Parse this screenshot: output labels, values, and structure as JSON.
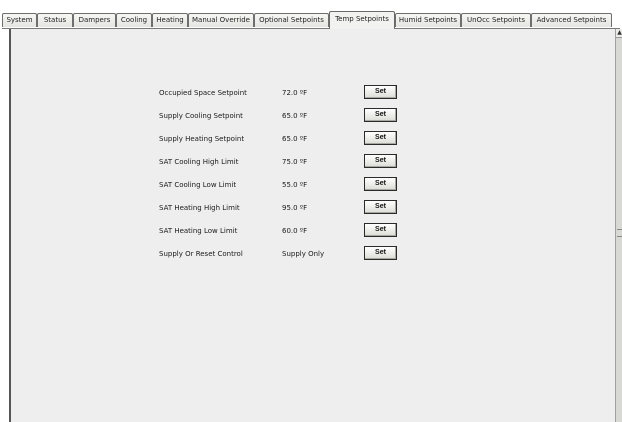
{
  "tabs": [
    {
      "label": "System"
    },
    {
      "label": "Status"
    },
    {
      "label": "Dampers"
    },
    {
      "label": "Cooling"
    },
    {
      "label": "Heating"
    },
    {
      "label": "Manual Override"
    },
    {
      "label": "Optional Setpoints"
    },
    {
      "label": "Temp Setpoints",
      "active": true
    },
    {
      "label": "Humid Setpoints"
    },
    {
      "label": "UnOcc Setpoints"
    },
    {
      "label": "Advanced Setpoints"
    }
  ],
  "setpoints": [
    {
      "label": "Occupied Space Setpoint",
      "value": "72.0 ºF",
      "button": "Set"
    },
    {
      "label": "Supply Cooling Setpoint",
      "value": "65.0 ºF",
      "button": "Set"
    },
    {
      "label": "Supply Heating Setpoint",
      "value": "65.0 ºF",
      "button": "Set"
    },
    {
      "label": "SAT Cooling High Limit",
      "value": "75.0 ºF",
      "button": "Set"
    },
    {
      "label": "SAT Cooling Low Limit",
      "value": "55.0 ºF",
      "button": "Set"
    },
    {
      "label": "SAT Heating High Limit",
      "value": "95.0 ºF",
      "button": "Set"
    },
    {
      "label": "SAT Heating Low Limit",
      "value": "60.0 ºF",
      "button": "Set"
    },
    {
      "label": "Supply Or Reset Control",
      "value": "Supply Only",
      "button": "Set"
    }
  ],
  "scrollbar": {
    "up_arrow_icon": "triangle-up-icon"
  }
}
